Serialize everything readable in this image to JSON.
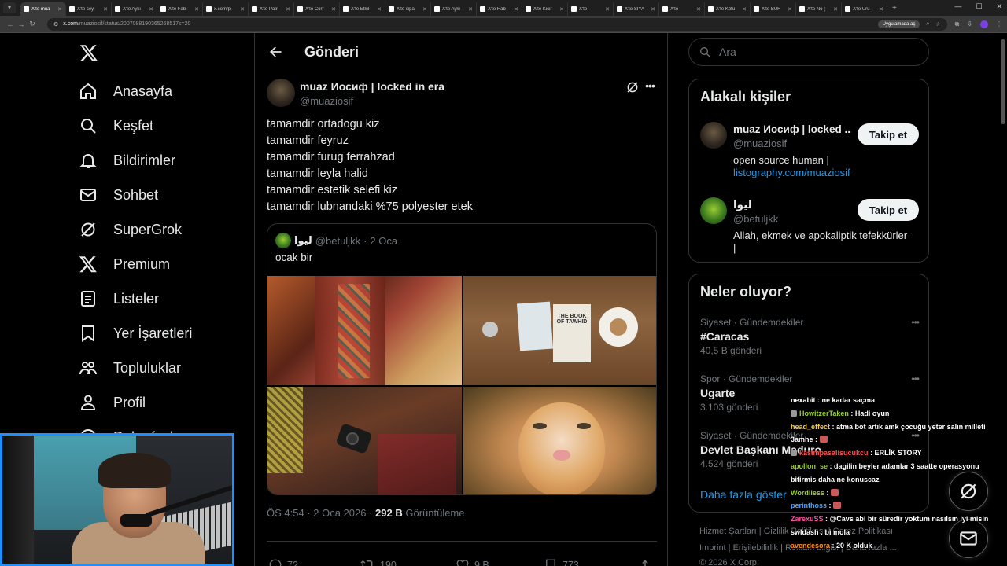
{
  "browser": {
    "tabs": [
      {
        "label": "X'te mua",
        "active": true
      },
      {
        "label": "X'te ceyi",
        "active": false
      },
      {
        "label": "X'te Aykı",
        "active": false
      },
      {
        "label": "X'te Fabi",
        "active": false
      },
      {
        "label": "x.com/p",
        "active": false
      },
      {
        "label": "X'te Patr",
        "active": false
      },
      {
        "label": "X'te Corr",
        "active": false
      },
      {
        "label": "X'te Etkil",
        "active": false
      },
      {
        "label": "X'te sipa",
        "active": false
      },
      {
        "label": "X'te Aykı",
        "active": false
      },
      {
        "label": "X'te Hab",
        "active": false
      },
      {
        "label": "X'te Kicir",
        "active": false
      },
      {
        "label": "X'te",
        "active": false
      },
      {
        "label": "X'te SİYA",
        "active": false
      },
      {
        "label": "X'te",
        "active": false
      },
      {
        "label": "X'te Kötü",
        "active": false
      },
      {
        "label": "X'te BUR",
        "active": false
      },
      {
        "label": "X'te No (",
        "active": false
      },
      {
        "label": "X'te Ürü",
        "active": false
      }
    ],
    "url_host": "x.com",
    "url_path": "/muaziosif/status/2007088190365268517s=20",
    "translate_pill": "Uygulamada aç"
  },
  "nav": {
    "items": [
      {
        "label": "Anasayfa",
        "icon": "home-icon"
      },
      {
        "label": "Keşfet",
        "icon": "search-icon"
      },
      {
        "label": "Bildirimler",
        "icon": "bell-icon"
      },
      {
        "label": "Sohbet",
        "icon": "mail-icon"
      },
      {
        "label": "SuperGrok",
        "icon": "grok-icon"
      },
      {
        "label": "Premium",
        "icon": "x-logo-icon"
      },
      {
        "label": "Listeler",
        "icon": "list-icon"
      },
      {
        "label": "Yer İşaretleri",
        "icon": "bookmark-icon"
      },
      {
        "label": "Topluluklar",
        "icon": "communities-icon"
      },
      {
        "label": "Profil",
        "icon": "profile-icon"
      },
      {
        "label": "Daha fazla",
        "icon": "more-circle-icon"
      }
    ]
  },
  "header": {
    "title": "Gönderi"
  },
  "tweet": {
    "author_name": "muaz Иосиф | locked in era",
    "author_handle": "@muaziosif",
    "lines": [
      "tamamdir ortadogu kiz",
      "tamamdir feyruz",
      "tamamdir furug ferrahzad",
      "tamamdir leyla halid",
      "tamamdir estetik selefi kiz",
      "tamamdir lubnandaki %75 polyester etek"
    ],
    "quote": {
      "name": "ليوا",
      "handle": "@betuljkk",
      "sep": "·",
      "date": "2 Oca",
      "text": "ocak bir"
    },
    "meta_time": "ÖS 4:54 · 2 Oca 2026 · ",
    "views_count": "292 B",
    "views_label": " Görüntüleme",
    "actions": {
      "replies": "72",
      "reposts": "190",
      "likes": "9 B",
      "bookmarks": "773"
    }
  },
  "search": {
    "placeholder": "Ara"
  },
  "related": {
    "title": "Alakalı kişiler",
    "people": [
      {
        "name": "muaz Иосиф | locked ...",
        "handle": "@muaziosif",
        "bio": "open source human |",
        "link": "listography.com/muaziosif",
        "follow": "Takip et"
      },
      {
        "name": "ليوا",
        "handle": "@betuljkk",
        "bio": "Allah, ekmek ve apokaliptik tefekkürler",
        "bio2": "|",
        "follow": "Takip et"
      }
    ]
  },
  "trends": {
    "title": "Neler oluyor?",
    "items": [
      {
        "category": "Siyaset · Gündemdekiler",
        "name": "#Caracas",
        "count": "40,5 B gönderi"
      },
      {
        "category": "Spor · Gündemdekiler",
        "name": "Ugarte",
        "count": "3.103 gönderi"
      },
      {
        "category": "Siyaset · Gündemdekiler",
        "name": "Devlet Başkanı Maduro",
        "count": "4.524 gönderi"
      }
    ],
    "show_more": "Daha fazla göster"
  },
  "footer": {
    "line1": "Hizmet Şartları  |  Gizlilik Politikası  |  Çerez Politikası",
    "line2": "Imprint  |  Erişilebilirlik  |  Reklam bilgisi  |  Daha fazla ...",
    "line3": "© 2026 X Corp."
  },
  "chat": [
    {
      "user": "nexabit",
      "color": "#ffffff",
      "msg": " : ne kadar saçma",
      "badge": false,
      "emote": false
    },
    {
      "user": "HowitzerTaken",
      "color": "#9acd32",
      "msg": " : Hadi oyun",
      "badge": true,
      "emote": false
    },
    {
      "user": "head_effect",
      "color": "#ffcc33",
      "msg": " : atma bot artık amk çocuğu yeter salın milleti",
      "badge": false,
      "emote": false
    },
    {
      "user": "3amhe",
      "color": "#ffffff",
      "msg": " : ",
      "badge": false,
      "emote": true
    },
    {
      "user": "kasimpasalisucukcu",
      "color": "#ff4d4d",
      "msg": " : ERLİK STORY",
      "badge": true,
      "emote": false
    },
    {
      "user": "apollon_se",
      "color": "#9acd32",
      "msg": " : dagilin beyler adamlar 3 saatte operasyonu",
      "badge": false,
      "emote": false
    },
    {
      "user": "",
      "color": "#ffffff",
      "msg": "bitirmis daha ne konuscaz",
      "badge": false,
      "emote": false
    },
    {
      "user": "Wordiless",
      "color": "#9acd32",
      "msg": " : ",
      "badge": false,
      "emote": true
    },
    {
      "user": "perinthoss",
      "color": "#4da6ff",
      "msg": " : ",
      "badge": false,
      "emote": true
    },
    {
      "user": "ZarexuSS",
      "color": "#ff4da6",
      "msg": " : @Cavs abi bir süredir yoktum nasılsın iyi misin",
      "badge": false,
      "emote": false
    },
    {
      "user": "swldash",
      "color": "#ffffff",
      "msg": " : bi mola",
      "badge": false,
      "emote": false
    },
    {
      "user": "avendesora",
      "color": "#ff8c1a",
      "msg": " : 20 K olduk",
      "badge": false,
      "emote": false
    }
  ],
  "colors": {
    "accent": "#1d9bf0",
    "border": "#2f3336",
    "muted": "#71767b",
    "webcam_border": "#1f8fff"
  }
}
